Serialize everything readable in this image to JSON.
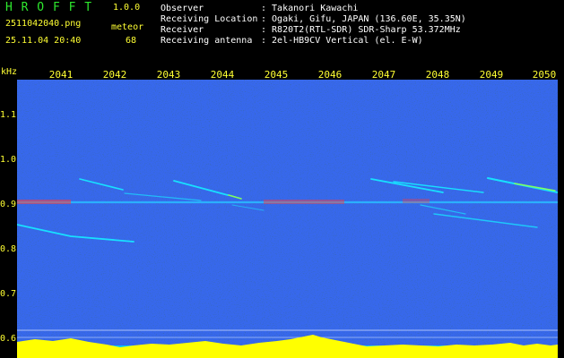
{
  "header": {
    "app_name": "H R O F F T",
    "version": "1.0.0",
    "filename": "2511042040.png",
    "datetime": "25.11.04 20:40",
    "meteor_label": "meteor",
    "meteor_count": "68",
    "info": [
      {
        "label": "Observer",
        "value": ": Takanori Kawachi"
      },
      {
        "label": "Receiving Location",
        "value": ": Ogaki, Gifu, JAPAN (136.60E, 35.35N)"
      },
      {
        "label": "Receiver",
        "value": ": R820T2(RTL-SDR) SDR-Sharp 53.372MHz"
      },
      {
        "label": "Receiving antenna",
        "value": ": 2el-HB9CV Vertical (el. E-W)"
      }
    ]
  },
  "axis": {
    "y_unit": "kHz",
    "y_ticks": [
      "1.1",
      "1.0",
      "0.9",
      "0.8",
      "0.7",
      "0.6"
    ],
    "x_ticks": [
      "2041",
      "2042",
      "2043",
      "2044",
      "2045",
      "2046",
      "2047",
      "2048",
      "2049",
      "2050"
    ]
  },
  "colors": {
    "background": "#000000",
    "spectrogram_bg": "#0a1a88",
    "noise": "#1e3cc8",
    "trace": "#00d8ff",
    "trace_hot": "#ff4040",
    "baseline": "#ffff00",
    "scale_text": "#ffff33",
    "title_green": "#2ee82e"
  }
}
